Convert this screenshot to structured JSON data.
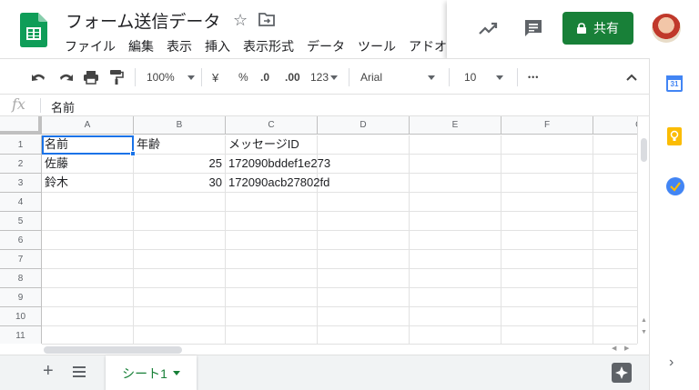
{
  "header": {
    "title": "フォーム送信データ",
    "menu": [
      "ファイル",
      "編集",
      "表示",
      "挿入",
      "表示形式",
      "データ",
      "ツール",
      "アドオ"
    ],
    "share_label": "共有"
  },
  "toolbar": {
    "zoom": "100%",
    "currency": "¥",
    "percent": "%",
    "decimal_decrease": ".0",
    "decimal_increase": ".00",
    "more_formats": "123",
    "font": "Arial",
    "font_size": "10",
    "more": "•••"
  },
  "formula_bar": {
    "fx": "fx",
    "value": "名前"
  },
  "columns": [
    "A",
    "B",
    "C",
    "D",
    "E",
    "F",
    "G"
  ],
  "rows": [
    "1",
    "2",
    "3",
    "4",
    "5",
    "6",
    "7",
    "8",
    "9",
    "10",
    "11"
  ],
  "cells": {
    "r1": {
      "a": "名前",
      "b": "年齢",
      "c": "メッセージID"
    },
    "r2": {
      "a": "佐藤",
      "b": "25",
      "c": "172090bddef1e273"
    },
    "r3": {
      "a": "鈴木",
      "b": "30",
      "c": "172090acb27802fd"
    }
  },
  "sheet_tab": "シート1",
  "side_panel": {
    "calendar_day": "31"
  },
  "colors": {
    "brand_green": "#188038",
    "selection_blue": "#1a73e8"
  }
}
